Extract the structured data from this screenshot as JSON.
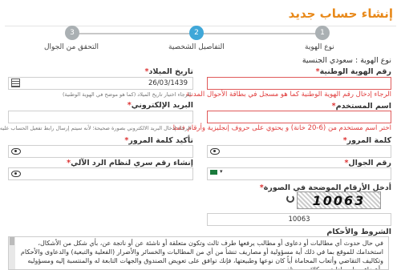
{
  "title": "إنشاء حساب جديد",
  "steps": [
    {
      "num": "1",
      "label": "نوع الهوية"
    },
    {
      "num": "2",
      "label": "التفاصيل الشخصية"
    },
    {
      "num": "3",
      "label": "التحقق من الجوال"
    }
  ],
  "id_type": {
    "label": "نوع الهوية :",
    "value": "سعودي الجنسية"
  },
  "national_id": {
    "label": "رقم الهوية الوطنية",
    "value": "",
    "error": "الرجاء إدخال رقم الهوية الوطنية كما هو مسجل في بطاقة الأحوال المدنية"
  },
  "birth_date": {
    "label": "تاريخ الميلاد",
    "value": "26/03/1439",
    "hint": "الرجاء اختيار تاريخ الميلاد (كما هو موضح في الهوية الوطنية)"
  },
  "email": {
    "label": "البريد الإلكتروني",
    "value": "",
    "hint": "الرجاء إدخال البريد الالكتروني بصورة صحيحة؛ لأنه سيتم إرسال رابط تفعيل الحساب عليه"
  },
  "username": {
    "label": "اسم المستخدم",
    "value": "",
    "error": "اختر اسم مستخدم من (6-20 خانة) و يحتوي على حروف إنجليزية وأرقام فقط"
  },
  "password": {
    "label": "كلمة المرور",
    "value": ""
  },
  "confirm_password": {
    "label": "تأكيد كلمة المرور",
    "value": ""
  },
  "mobile": {
    "label": "رقم الجوال",
    "value": ""
  },
  "ivr_pin": {
    "label": "إنشاء رقم سري لنظام الرد الآلي",
    "value": ""
  },
  "captcha": {
    "label": "أدخل الأرقام الموضحة في الصورة",
    "image_text": "10063",
    "value": "10063"
  },
  "terms": {
    "label": "الشروط والأحكام",
    "text": "في حال حدوث أي مطالبات أو دعاوى أو مطالب يرفعها طرف ثالث وتكون متعلقة أو ناشئة عن أو ناتجة عن، بأي شكل من الأشكال، استخدامك للموقع بما في ذلك أية مسؤولية أو مصاريف تنشأ من أي من المطالبات والخسائر والأضرار (الفعلية والتبعية) والدعاوى والأحكام وتكاليف التقاضي وأتعاب المحاماة أياً كان نوعها وطبيعتها، فإنك توافق على تعويض الصندوق والجهات التابعة له والمنتسبة إليه ومسؤوليه وأعضاء مجلس إدارته ووكلائه وموظفيه."
  },
  "colors": {
    "accent": "#e8891a",
    "active_step": "#3fa7d8",
    "error": "#e03b3b"
  }
}
